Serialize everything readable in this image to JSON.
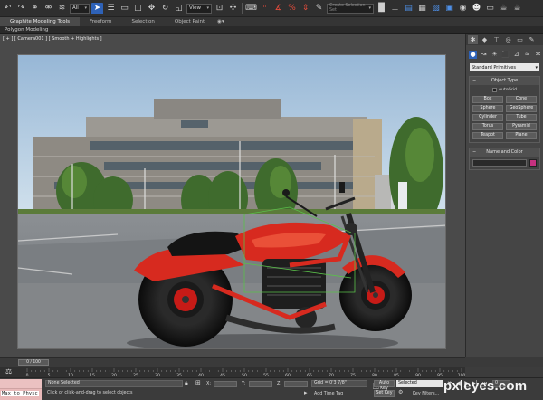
{
  "toolbar": {
    "selection_filter": "All",
    "reference_coordinate": "View",
    "named_selection_placeholder": "Create Selection Set"
  },
  "ribbon": {
    "tabs": [
      "Graphite Modeling Tools",
      "Freeform",
      "Selection",
      "Object Paint"
    ],
    "panel_label": "Polygon Modeling"
  },
  "viewport": {
    "label": "[ + ] [ Camera001 ] [ Smooth + Highlights ]"
  },
  "command_panel": {
    "category": "Standard Primitives",
    "object_type_title": "Object Type",
    "autogrid_label": "AutoGrid",
    "primitives": [
      "Box",
      "Cone",
      "Sphere",
      "GeoSphere",
      "Cylinder",
      "Tube",
      "Torus",
      "Pyramid",
      "Teapot",
      "Plane"
    ],
    "name_color_title": "Name and Color",
    "object_color": "#c6317f"
  },
  "time_slider": {
    "frame_display": "0 / 100"
  },
  "trackbar": {
    "ticks": [
      "0",
      "5",
      "10",
      "15",
      "20",
      "25",
      "30",
      "35",
      "40",
      "45",
      "50",
      "55",
      "60",
      "65",
      "70",
      "75",
      "80",
      "85",
      "90",
      "95",
      "100"
    ]
  },
  "status_bar": {
    "maxscript_text": "Max to Physc",
    "selection_status": "None Selected",
    "prompt": "Click or click-and-drag to select objects",
    "x_label": "X:",
    "y_label": "Y:",
    "z_label": "Z:",
    "grid": "Grid = 0'3 7/8\"",
    "add_time_tag": "Add Time Tag",
    "auto_key": "Auto Key",
    "set_key": "Set Key",
    "key_filters": "Key Filters...",
    "key_mode": "Selected",
    "current_frame": "0"
  },
  "watermark": "pxleyes.com"
}
